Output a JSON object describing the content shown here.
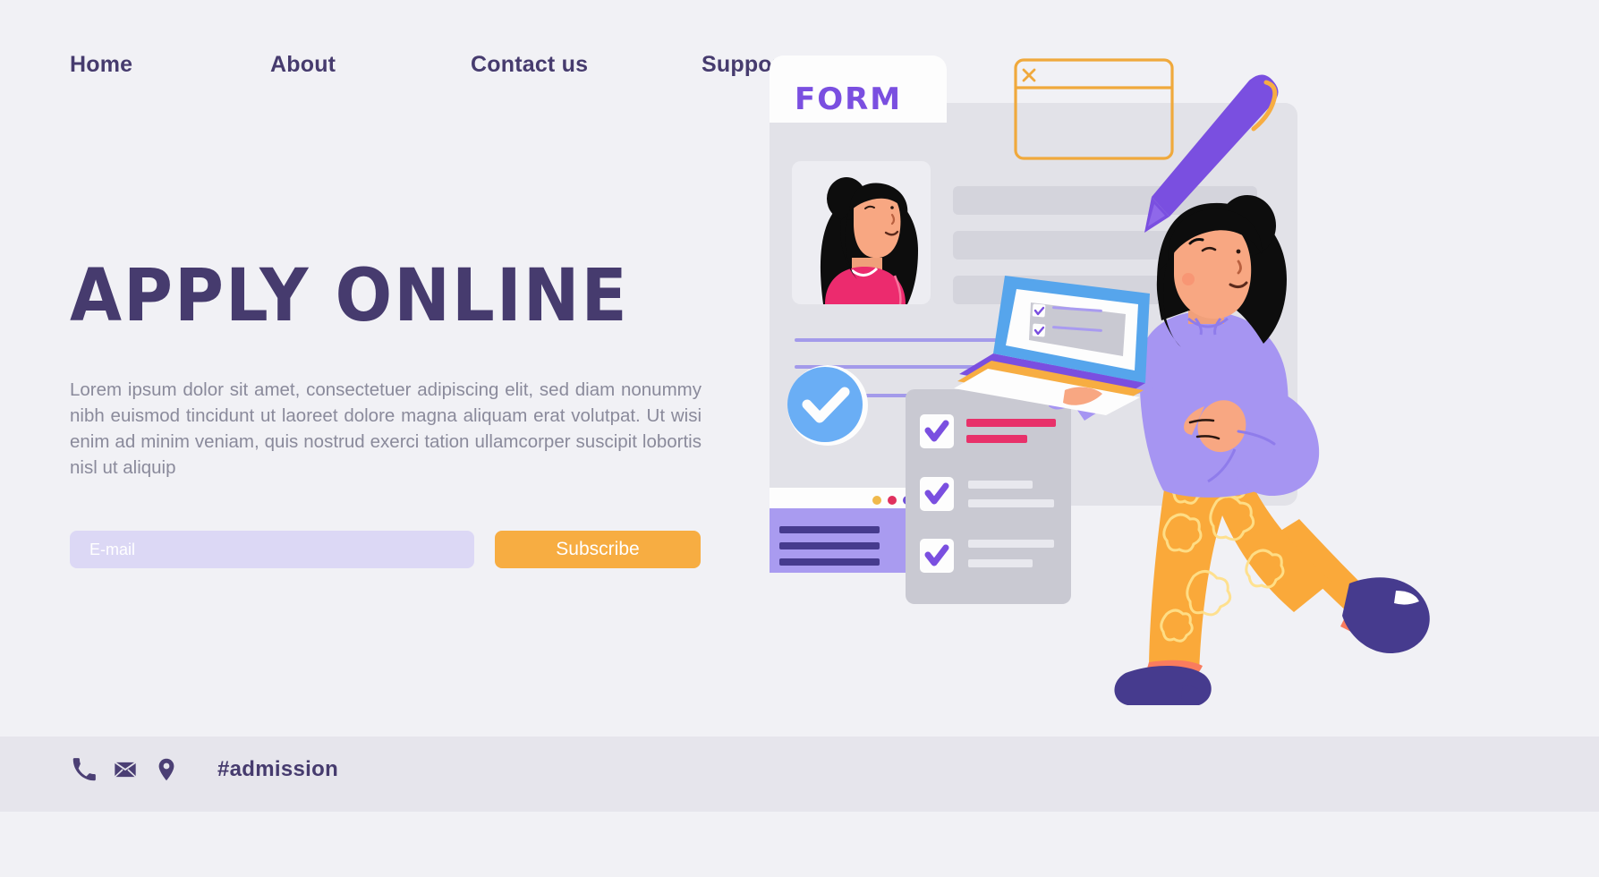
{
  "theme": {
    "background": "#f1f1f5",
    "footer_band": "#e6e5ec",
    "primary_purple": "#463b6e",
    "accent_violet": "#7a4fe0",
    "accent_orange": "#f7ad42",
    "accent_pink": "#e8316a",
    "accent_blue": "#6aaef5",
    "input_lavender": "#dcd8f5",
    "body_gray": "#8a8a9b"
  },
  "nav": {
    "items": [
      {
        "label": "Home"
      },
      {
        "label": "About"
      },
      {
        "label": "Contact us"
      },
      {
        "label": "Support"
      }
    ]
  },
  "hero": {
    "title": "APPLY ONLINE",
    "body": "Lorem ipsum dolor sit amet, consectetuer adipiscing elit, sed diam nonummy nibh euismod tincidunt ut laoreet dolore magna aliquam erat volutpat. Ut wisi enim ad minim veniam, quis nostrud exerci tation ullamcorper suscipit lobortis nisl ut aliquip"
  },
  "signup": {
    "email_placeholder": "E-mail",
    "email_value": "",
    "subscribe_label": "Subscribe"
  },
  "footer": {
    "icons": [
      {
        "name": "phone-icon"
      },
      {
        "name": "envelope-icon"
      },
      {
        "name": "location-pin-icon"
      }
    ],
    "hashtag": "#admission"
  },
  "illustration": {
    "form_card": {
      "tab_label": "FORM",
      "avatar": "woman-portrait-photo",
      "placeholder_bars": 3,
      "underlines": 3
    },
    "window_top_right": {
      "close_icon": "close-x-icon",
      "border_color": "#f0a93c"
    },
    "pen": {
      "name": "stylus-pen-icon",
      "body_color": "#7a4fe0",
      "clip_color": "#f7ad42"
    },
    "approved_badge": {
      "name": "check-circle-icon",
      "color": "#6aaef5"
    },
    "browser_card": {
      "dots": [
        "#f0b94c",
        "#e0305e",
        "#6f4fd8"
      ],
      "body_color": "#a99bf0",
      "bars": 3
    },
    "checklist_card": {
      "rows": [
        {
          "checked": true,
          "line_color": "#e8316a"
        },
        {
          "checked": true,
          "line_color": "#e8e8ee"
        },
        {
          "checked": true,
          "line_color": "#e8e8ee"
        }
      ]
    },
    "laptop": {
      "bezel_color": "#56a5ec",
      "base_color": "#7a4fe0",
      "screen_rows": 2
    },
    "character": {
      "name": "woman-holding-laptop",
      "hair": "#111111",
      "skin": "#f59a75",
      "sweater": "#a695f2",
      "pants": "#faa93a",
      "shoes": "#463b8e"
    }
  }
}
